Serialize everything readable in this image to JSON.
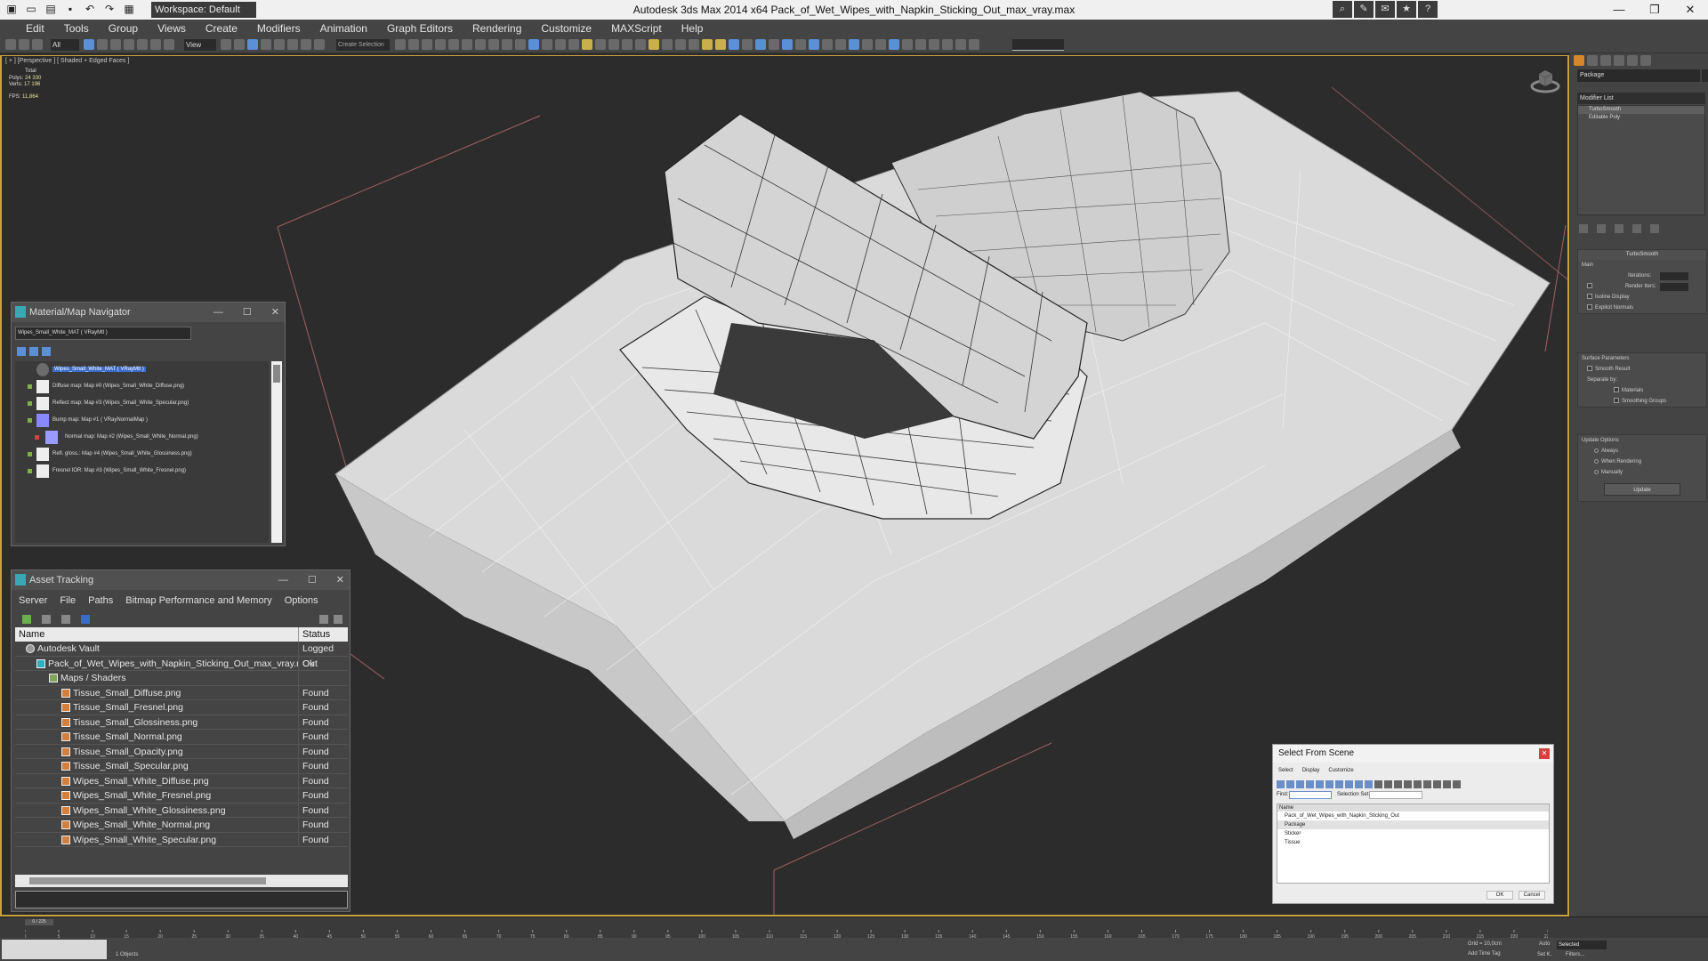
{
  "titlebar": {
    "app_title": "Autodesk 3ds Max  2014 x64     Pack_of_Wet_Wipes_with_Napkin_Sticking_Out_max_vray.max",
    "workspace": "Workspace: Default"
  },
  "menu": {
    "items": [
      "Edit",
      "Tools",
      "Group",
      "Views",
      "Create",
      "Modifiers",
      "Animation",
      "Graph Editors",
      "Rendering",
      "Customize",
      "MAXScript",
      "Help"
    ]
  },
  "toolbar": {
    "selection_filter": "All",
    "ref_coord": "View",
    "named_selection": "Create Selection"
  },
  "viewport": {
    "label": "[ + ] [Perspective ] [ Shaded + Edged Faces ]",
    "stats": {
      "total_label": "Total",
      "polys_label": "Polys:",
      "polys_value": "24 330",
      "verts_label": "Verts:",
      "verts_value": "17 196",
      "fps_label": "FPS:",
      "fps_value": "11,864"
    }
  },
  "command_panel": {
    "object_name": "Package",
    "modifier_list": "Modifier List",
    "stack": [
      "TurboSmooth",
      "Editable Poly"
    ],
    "turbosmooth": {
      "title": "TurboSmooth",
      "main": "Main",
      "iterations": "Iterations:",
      "render_iters": "Render Iters:",
      "isoline": "Isoline Display",
      "explicit_normals": "Explicit Normals",
      "surface_params": "Surface Parameters",
      "smooth_result": "Smooth Result",
      "separate_by": "Separate by:",
      "materials": "Materials",
      "smoothing_groups": "Smoothing Groups",
      "update_options": "Update Options",
      "always": "Always",
      "when_rendering": "When Rendering",
      "manually": "Manually",
      "update_btn": "Update"
    }
  },
  "material_navigator": {
    "title": "Material/Map Navigator",
    "field": "Wipes_Small_White_MAT  ( VRayMtl )",
    "items": [
      "Wipes_Small_White_MAT  ( VRayMtl )",
      "Diffuse map: Map #0 (Wipes_Small_White_Diffuse.png)",
      "Reflect map: Map #3 (Wipes_Small_White_Specular.png)",
      "Bump map: Map #1  ( VRayNormalMap )",
      "Normal map: Map #2 (Wipes_Small_White_Normal.png)",
      "Refl. gloss.: Map #4 (Wipes_Small_White_Glossiness.png)",
      "Fresnel IOR: Map #3 (Wipes_Small_White_Fresnel.png)"
    ]
  },
  "asset_tracking": {
    "title": "Asset Tracking",
    "menu": [
      "Server",
      "File",
      "Paths",
      "Bitmap Performance and Memory",
      "Options"
    ],
    "col_name": "Name",
    "col_status": "Status",
    "rows": [
      {
        "name": "Autodesk Vault",
        "status": "Logged Out"
      },
      {
        "name": "Pack_of_Wet_Wipes_with_Napkin_Sticking_Out_max_vray.max",
        "status": "Ok"
      },
      {
        "name": "Maps / Shaders",
        "status": ""
      },
      {
        "name": "Tissue_Small_Diffuse.png",
        "status": "Found"
      },
      {
        "name": "Tissue_Small_Fresnel.png",
        "status": "Found"
      },
      {
        "name": "Tissue_Small_Glossiness.png",
        "status": "Found"
      },
      {
        "name": "Tissue_Small_Normal.png",
        "status": "Found"
      },
      {
        "name": "Tissue_Small_Opacity.png",
        "status": "Found"
      },
      {
        "name": "Tissue_Small_Specular.png",
        "status": "Found"
      },
      {
        "name": "Wipes_Small_White_Diffuse.png",
        "status": "Found"
      },
      {
        "name": "Wipes_Small_White_Fresnel.png",
        "status": "Found"
      },
      {
        "name": "Wipes_Small_White_Glossiness.png",
        "status": "Found"
      },
      {
        "name": "Wipes_Small_White_Normal.png",
        "status": "Found"
      },
      {
        "name": "Wipes_Small_White_Specular.png",
        "status": "Found"
      }
    ]
  },
  "select_from_scene": {
    "title": "Select From Scene",
    "menu": [
      "Select",
      "Display",
      "Customize"
    ],
    "find_label": "Find:",
    "selection_set_label": "Selection Set:",
    "col_name": "Name",
    "items": [
      "Pack_of_Wet_Wipes_with_Napkin_Sticking_Out",
      "Package",
      "Sticker",
      "Tissue"
    ],
    "ok": "OK",
    "cancel": "Cancel"
  },
  "timeline": {
    "slider": "0 / 225",
    "ticks": [
      "0",
      "5",
      "10",
      "15",
      "20",
      "25",
      "30",
      "35",
      "40",
      "45",
      "50",
      "55",
      "60",
      "65",
      "70",
      "75",
      "80",
      "85",
      "90",
      "95",
      "100",
      "105",
      "110",
      "115",
      "120",
      "125",
      "130",
      "135",
      "140",
      "145",
      "150",
      "155",
      "160",
      "165",
      "170",
      "175",
      "180",
      "185",
      "190",
      "195",
      "200",
      "205",
      "210",
      "215",
      "220",
      "225"
    ]
  },
  "statusbar": {
    "objects": "1 Objects",
    "grid": "Grid = 10,0cm",
    "add_time_tag": "Add Time Tag",
    "auto": "Auto",
    "selected": "Selected",
    "set_k": "Set K.",
    "filters": "Filters..."
  },
  "colors": {
    "viewport_bg": "#2c2c2c",
    "viewport_border": "#c8a23c",
    "panel": "#444444",
    "accent_blue": "#3a6cc9"
  }
}
